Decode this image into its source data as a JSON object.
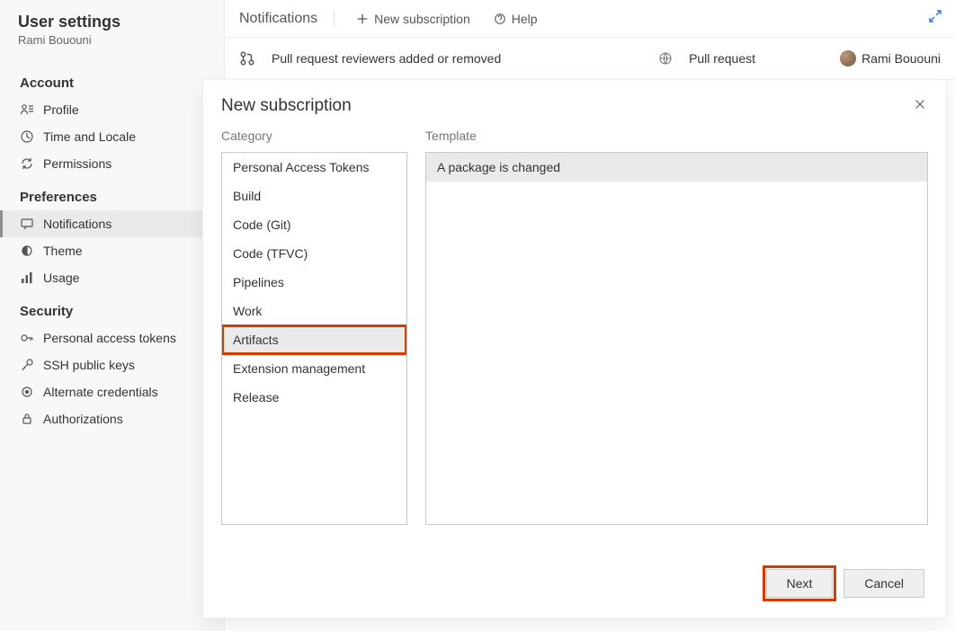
{
  "sidebar": {
    "title": "User settings",
    "user": "Rami Bououni",
    "sections": [
      {
        "label": "Account",
        "items": [
          {
            "icon": "person-icon",
            "label": "Profile"
          },
          {
            "icon": "clock-icon",
            "label": "Time and Locale"
          },
          {
            "icon": "refresh-icon",
            "label": "Permissions"
          }
        ]
      },
      {
        "label": "Preferences",
        "items": [
          {
            "icon": "chat-icon",
            "label": "Notifications",
            "selected": true
          },
          {
            "icon": "theme-icon",
            "label": "Theme"
          },
          {
            "icon": "usage-icon",
            "label": "Usage"
          }
        ]
      },
      {
        "label": "Security",
        "items": [
          {
            "icon": "key-icon",
            "label": "Personal access tokens"
          },
          {
            "icon": "ssh-icon",
            "label": "SSH public keys"
          },
          {
            "icon": "alt-icon",
            "label": "Alternate credentials"
          },
          {
            "icon": "lock-icon",
            "label": "Authorizations"
          }
        ]
      }
    ]
  },
  "toolbar": {
    "page_title": "Notifications",
    "new_sub_label": "New subscription",
    "help_label": "Help"
  },
  "table": {
    "row_desc": "Pull request reviewers added or removed",
    "row_type": "Pull request",
    "row_user": "Rami Bououni"
  },
  "modal": {
    "title": "New subscription",
    "category_label": "Category",
    "template_label": "Template",
    "categories": [
      "Personal Access Tokens",
      "Build",
      "Code (Git)",
      "Code (TFVC)",
      "Pipelines",
      "Work",
      "Artifacts",
      "Extension management",
      "Release"
    ],
    "selected_category_index": 6,
    "templates": [
      "A package is changed"
    ],
    "selected_template_index": 0,
    "next_label": "Next",
    "cancel_label": "Cancel"
  }
}
